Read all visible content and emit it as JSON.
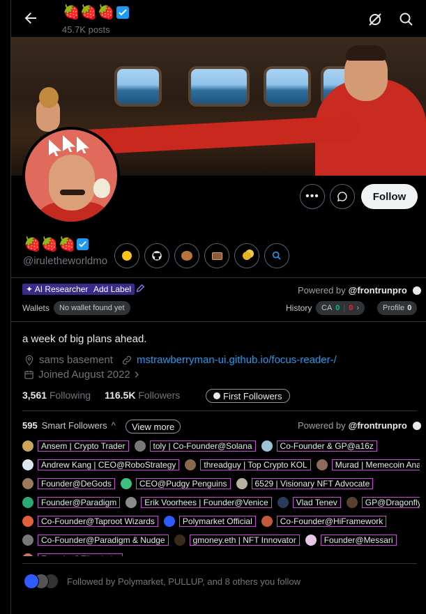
{
  "header": {
    "display_name_emoji": "🍓🍓🍓",
    "posts_count": "45.7K posts"
  },
  "profile": {
    "display_name_emoji": "🍓🍓🍓",
    "handle": "@iruletheworldmo",
    "follow_label": "Follow",
    "bio": "a week of big plans ahead.",
    "location": "sams basement",
    "website": "mstrawberryman-ui.github.io/focus-reader-/",
    "joined": "Joined August 2022",
    "following_count": "3,561",
    "following_label": "Following",
    "followers_count": "116.5K",
    "followers_label": "Followers",
    "first_followers_label": "First Followers"
  },
  "social_icons": [
    "smiley-icon",
    "github-icon",
    "bear-icon",
    "wallet-icon",
    "coins-icon",
    "search-icon"
  ],
  "frontrun": {
    "tag_ai": "✦ AI Researcher",
    "add_label": "Add Label",
    "powered_by": "Powered by",
    "brand": "@frontrunpro",
    "wallets_label": "Wallets",
    "wallets_value": "No wallet found yet",
    "history_label": "History",
    "ca_label": "CA",
    "ca_green": "0",
    "ca_red": "0",
    "profile_label": "Profile",
    "profile_value": "0"
  },
  "smart_followers": {
    "count": "595",
    "label": "Smart Followers",
    "view_more": "View more",
    "powered_by": "Powered by",
    "brand": "@frontrunpro",
    "rows": [
      [
        {
          "label": "Ansem | Crypto Trader",
          "color": "#c9a45a"
        },
        {
          "label": "toly | Co-Founder@Solana",
          "color": "#777777"
        },
        {
          "label": "Co-Founder & GP@a16z",
          "color": "#9ec2d8"
        }
      ],
      [
        {
          "label": "Andrew Kang | CEO@RoboStrategy",
          "color": "#dde6ee"
        },
        {
          "label": "threadguy | Top Crypto KOL",
          "color": "#8a6a4e"
        },
        {
          "label": "Murad | Memecoin Analyst",
          "color": "#8e6a5a"
        }
      ],
      [
        {
          "label": "Founder@DeGods",
          "color": "#9a7a5a"
        },
        {
          "label": "CEO@Pudgy Penguins",
          "color": "#3fbf7f"
        },
        {
          "label": "6529 | Visionary NFT Advocate",
          "color": "#b8b0a0"
        }
      ],
      [
        {
          "label": "Founder@Paradigm",
          "color": "#2aa876"
        },
        {
          "label": "Erik Voorhees | Founder@Venice",
          "color": "#8a8a8a"
        },
        {
          "label": "Vlad Tenev",
          "color": "#2a3a5a"
        },
        {
          "label": "GP@Dragonfly",
          "color": "#5a4030"
        }
      ],
      [
        {
          "label": "Co-Founder@Taproot Wizards",
          "color": "#e0603a"
        },
        {
          "label": "Polymarket Official",
          "color": "#2e5bff"
        },
        {
          "label": "Co-Founder@HiFramework",
          "color": "#c05a3a"
        }
      ],
      [
        {
          "label": "Co-Founder@Paradigm & Nudge",
          "color": "#777777"
        },
        {
          "label": "gmoney.eth | NFT Innovator",
          "color": "#3a2a1a"
        },
        {
          "label": "Founder@Messari",
          "color": "#e6c8e6"
        }
      ],
      [
        {
          "label": "Founder@Eliza Labs",
          "color": "#c87a6a"
        }
      ]
    ]
  },
  "followed_by": "Followed by Polymarket, PULLUP, and 8 others you follow"
}
